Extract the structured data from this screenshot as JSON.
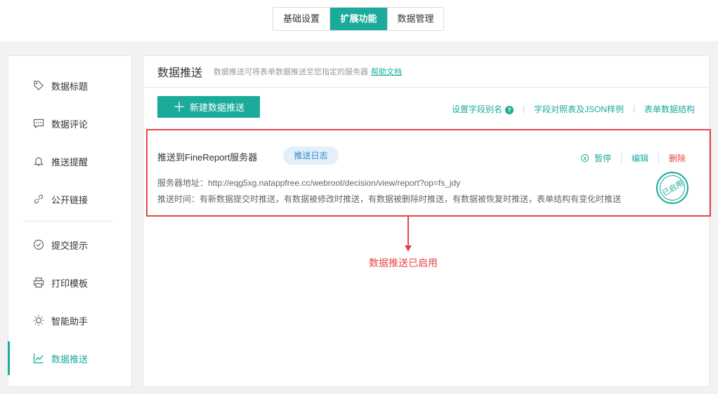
{
  "top_tabs": [
    {
      "label": "基础设置",
      "active": false
    },
    {
      "label": "扩展功能",
      "active": true
    },
    {
      "label": "数据管理",
      "active": false
    }
  ],
  "sidebar": {
    "items": [
      {
        "label": "数据标题",
        "icon": "tag-icon"
      },
      {
        "label": "数据评论",
        "icon": "comment-icon"
      },
      {
        "label": "推送提醒",
        "icon": "bell-icon"
      },
      {
        "label": "公开链接",
        "icon": "link-icon"
      },
      {
        "label": "提交提示",
        "icon": "check-circle-icon"
      },
      {
        "label": "打印模板",
        "icon": "printer-icon"
      },
      {
        "label": "智能助手",
        "icon": "bulb-icon"
      },
      {
        "label": "数据推送",
        "icon": "chart-icon",
        "active": true
      }
    ]
  },
  "panel": {
    "title": "数据推送",
    "desc": "数据推送可将表单数据推送至您指定的服务器",
    "help": "帮助文档",
    "new_button": "新建数据推送",
    "links": [
      "设置字段别名",
      "字段对照表及JSON样例",
      "表单数据结构"
    ]
  },
  "card": {
    "title": "推送到FineReport服务器",
    "log_badge": "推送日志",
    "pause": "暂停",
    "edit": "编辑",
    "delete": "删除",
    "server_line": "服务器地址：http://eqg5xg.natappfree.cc/webroot/decision/view/report?op=fs_jdy",
    "time_line": "推送时间：有新数据提交时推送，有数据被修改时推送，有数据被删除时推送，有数据被恢复时推送，表单结构有变化时推送",
    "stamp": "已启用"
  },
  "annotation": "数据推送已启用",
  "colors": {
    "accent": "#1aab9b",
    "danger": "#e84545",
    "badge_bg": "#e3f0f9",
    "badge_text": "#2f88c9"
  }
}
